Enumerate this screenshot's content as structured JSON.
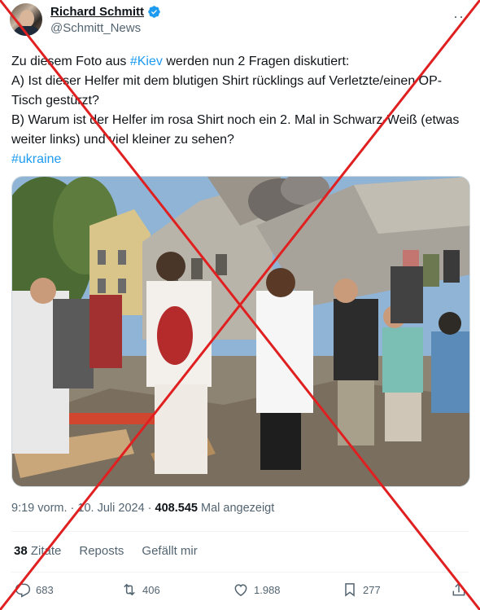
{
  "author": {
    "name": "Richard Schmitt",
    "handle": "@Schmitt_News"
  },
  "tweet": {
    "line1_pre": "Zu diesem Foto aus ",
    "line1_tag": "#Kiev",
    "line1_post": " werden nun 2 Fragen diskutiert:",
    "question_a": "A) Ist dieser Helfer mit dem blutigen Shirt rücklings auf Verletzte/einen OP-Tisch gestürzt?",
    "question_b": "B) Warum ist der Helfer im rosa Shirt noch ein 2. Mal in Schwarz-Weiß (etwas weiter links) und viel kleiner zu sehen?",
    "hashtag": "#ukraine"
  },
  "meta": {
    "time": "9:19 vorm.",
    "separator": "·",
    "date": "10. Juli 2024",
    "views_count": "408.545",
    "views_label": "Mal angezeigt"
  },
  "engagement": {
    "quotes_count": "38",
    "quotes_label": "Zitate",
    "reposts_label": "Reposts",
    "likes_label": "Gefällt mir"
  },
  "actions": {
    "replies": "683",
    "retweets": "406",
    "likes": "1.988",
    "bookmarks": "277"
  },
  "colors": {
    "accent": "#1d9bf0",
    "cross": "#e02020",
    "muted": "#536471"
  }
}
